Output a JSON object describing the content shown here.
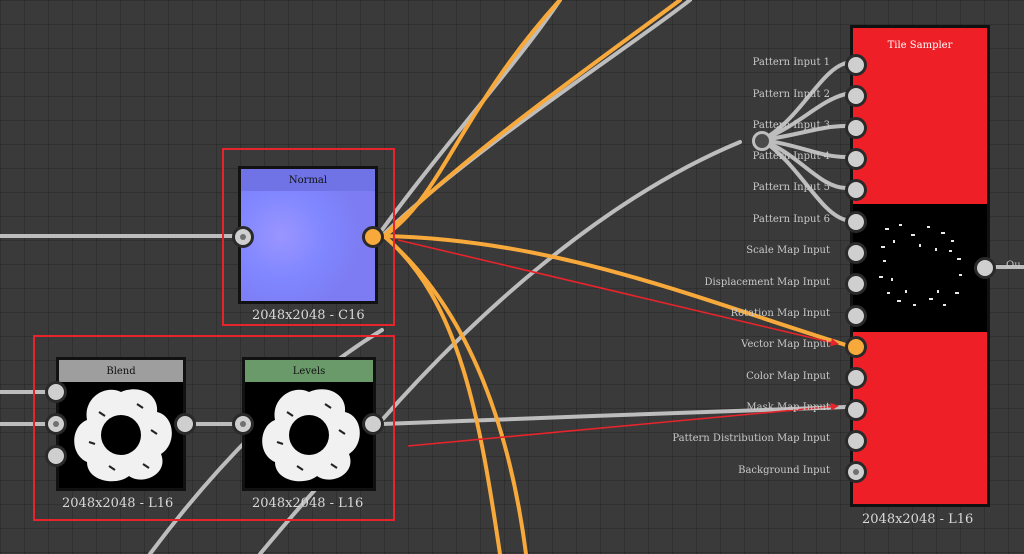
{
  "nodes": {
    "normal": {
      "title": "Normal",
      "size": "2048x2048 - C16"
    },
    "blend": {
      "title": "Blend",
      "size": "2048x2048 - L16"
    },
    "levels": {
      "title": "Levels",
      "size": "2048x2048 - L16"
    },
    "tile_sampler": {
      "title": "Tile Sampler",
      "size": "2048x2048 - L16",
      "output_label": "Ou",
      "inputs": [
        "Pattern Input 1",
        "Pattern Input 2",
        "Pattern Input 3",
        "Pattern Input 4",
        "Pattern Input 5",
        "Pattern Input 6",
        "Scale Map Input",
        "Displacement Map Input",
        "Rotation Map Input",
        "Vector Map Input",
        "Color Map Input",
        "Mask Map Input",
        "Pattern Distribution Map Input",
        "Background Input"
      ]
    }
  },
  "colors": {
    "canvas_bg": "#3a3a3a",
    "wire_gray": "#bdbdbd",
    "wire_orange": "#f7a93b",
    "annotation_red": "#e5242b",
    "normal_header": "#6f73e6",
    "blend_header": "#9e9e9e",
    "levels_header": "#6a9a6a",
    "tile_sampler_body": "#ee1f26"
  }
}
